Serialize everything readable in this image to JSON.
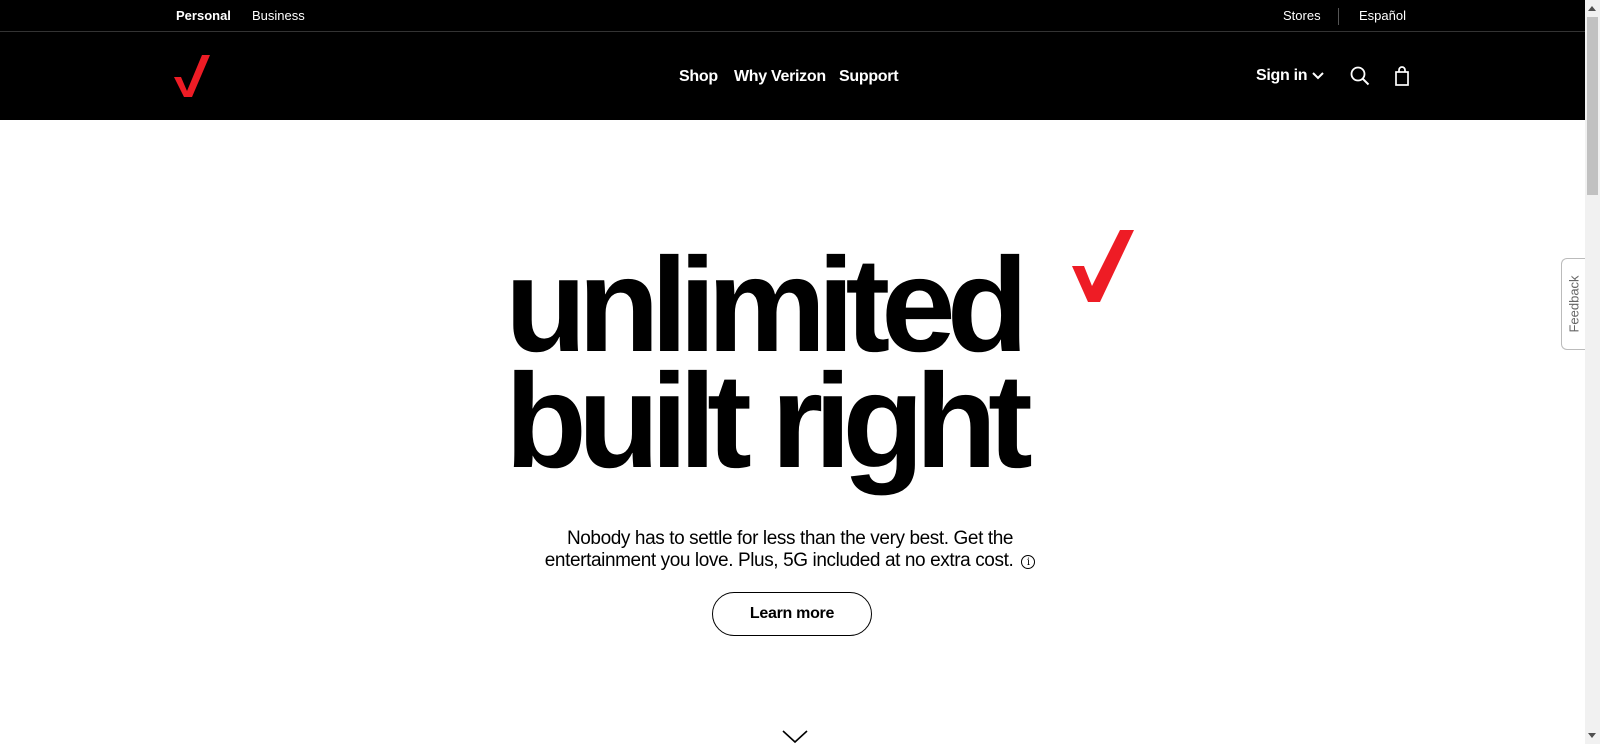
{
  "utility_bar": {
    "personal": "Personal",
    "business": "Business",
    "stores": "Stores",
    "espanol": "Español"
  },
  "nav": {
    "shop": "Shop",
    "why_verizon": "Why Verizon",
    "support": "Support",
    "sign_in": "Sign in"
  },
  "hero": {
    "title_line1": "unlimited",
    "title_line2": "built right",
    "body": "Nobody has to settle for less than the very best. Get the entertainment you love. Plus, 5G included at no extra cost.",
    "info_glyph": "i",
    "cta": "Learn more"
  },
  "feedback": {
    "label": "Feedback"
  },
  "colors": {
    "brand_red": "#ee1c25",
    "nav_bg": "#000000"
  },
  "icons": [
    "verizon-check-logo",
    "chevron-down-icon",
    "search-icon",
    "cart-icon",
    "info-icon",
    "scroll-down-chevron-icon"
  ]
}
